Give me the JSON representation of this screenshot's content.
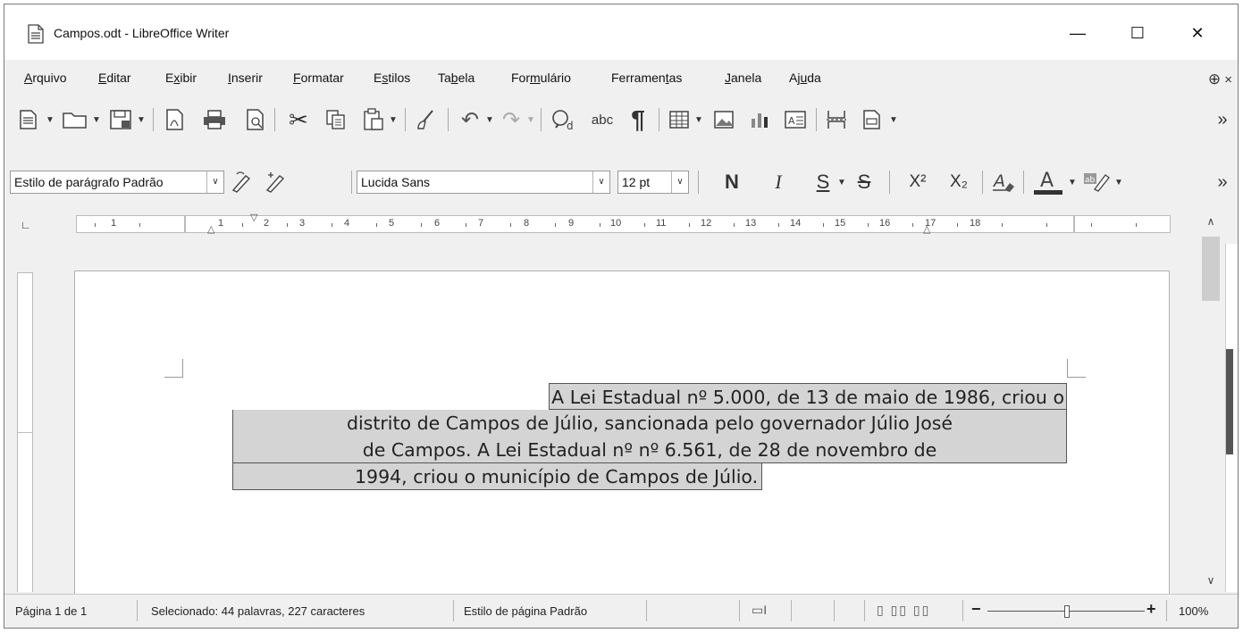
{
  "window": {
    "title": "Campos.odt - LibreOffice Writer",
    "controls": {
      "minimize": "—",
      "maximize": "☐",
      "close": "✕"
    }
  },
  "menubar": {
    "items": [
      {
        "pre": "",
        "u": "A",
        "post": "rquivo"
      },
      {
        "pre": "",
        "u": "E",
        "post": "ditar"
      },
      {
        "pre": "E",
        "u": "x",
        "post": "ibir"
      },
      {
        "pre": "",
        "u": "I",
        "post": "nserir"
      },
      {
        "pre": "",
        "u": "F",
        "post": "ormatar"
      },
      {
        "pre": "E",
        "u": "s",
        "post": "tilos"
      },
      {
        "pre": "Ta",
        "u": "b",
        "post": "ela"
      },
      {
        "pre": "For",
        "u": "m",
        "post": "ulário"
      },
      {
        "pre": "Ferramen",
        "u": "t",
        "post": "as"
      },
      {
        "pre": "",
        "u": "J",
        "post": "anela"
      },
      {
        "pre": "Aj",
        "u": "u",
        "post": "da"
      }
    ],
    "right_close": "×"
  },
  "formatting": {
    "paragraph_style": "Estilo de parágrafo Padrão",
    "font_name": "Lucida Sans",
    "font_size": "12 pt",
    "bold": "N",
    "italic": "I",
    "underline": "S",
    "strike": "S",
    "superscript": "X²",
    "subscript": "X₂",
    "more": "»"
  },
  "standard_toolbar": {
    "formatting_marks": "¶",
    "spellcheck": "abc",
    "more": "»"
  },
  "ruler": {
    "numbers": [
      "1",
      "1",
      "2",
      "3",
      "4",
      "5",
      "6",
      "7",
      "8",
      "9",
      "10",
      "11",
      "12",
      "13",
      "14",
      "15",
      "16",
      "17",
      "18"
    ]
  },
  "document": {
    "lines": [
      "A Lei Estadual nº 5.000, de 13 de maio de 1986, criou o",
      "distrito de Campos de Júlio, sancionada pelo governador Júlio José",
      "de Campos. A Lei Estadual nº nº 6.561, de 28 de novembro de",
      "1994, criou o município de Campos de Júlio."
    ]
  },
  "statusbar": {
    "page": "Página 1 de 1",
    "selection": "Selecionado: 44 palavras, 227 caracteres",
    "page_style": "Estilo de página Padrão",
    "zoom": "100%"
  }
}
